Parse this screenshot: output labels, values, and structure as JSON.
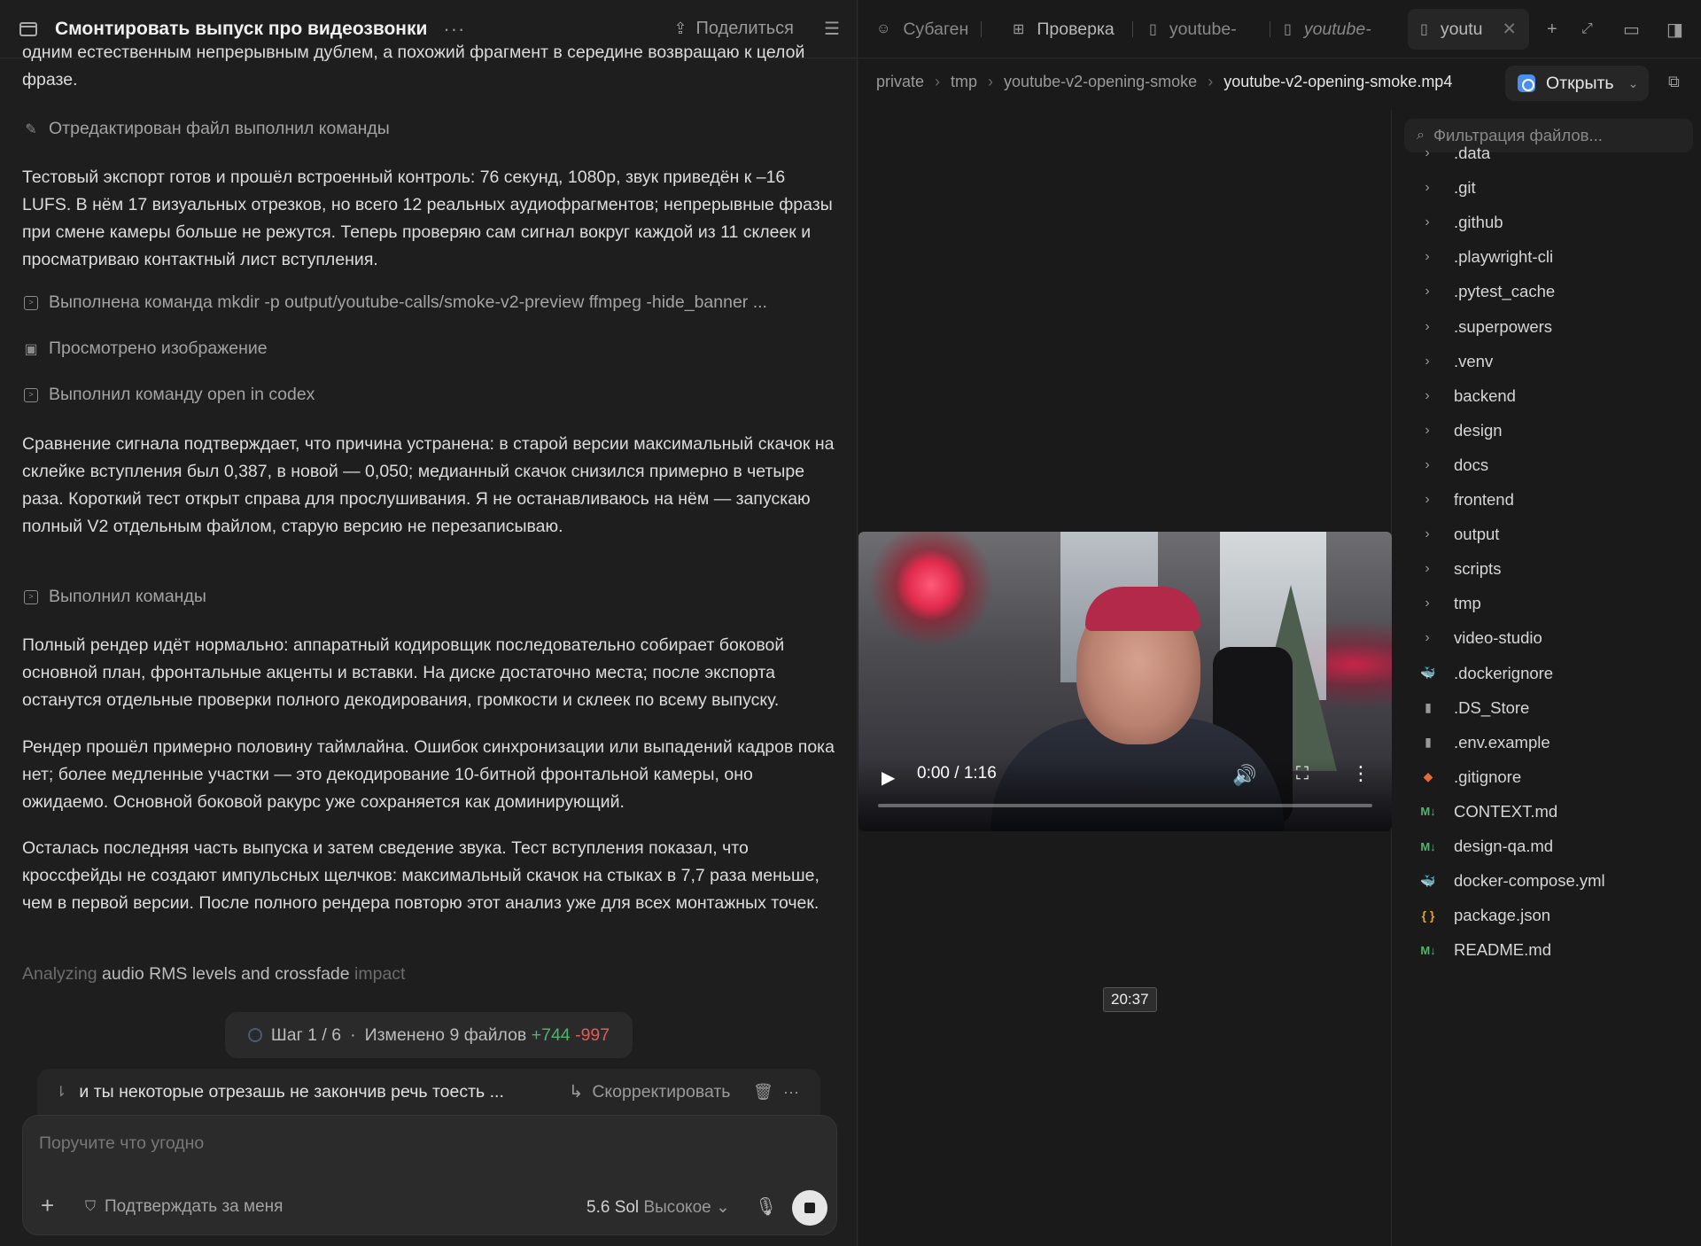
{
  "header": {
    "title": "Смонтировать выпуск про видеозвонки",
    "more": "···",
    "share_label": "Поделиться"
  },
  "chat": {
    "top_fragment": "одним естественным непрерывным дублем, а похожий фрагмент в середине возвращаю к целой фразе.",
    "actions": {
      "edited": "Отредактирован файл выполнил команды",
      "mkdir": "Выполнена команда mkdir -p output/youtube-calls/smoke-v2-preview ffmpeg -hide_banner ...",
      "viewed": "Просмотрено изображение",
      "open": "Выполнил команду open in codex",
      "commands": "Выполнил команды"
    },
    "p1": "Тестовый экспорт готов и прошёл встроенный контроль: 76 секунд, 1080p, звук приведён к –16 LUFS. В нём 17 визуальных отрезков, но всего 12 реальных аудиофрагментов; непрерывные фразы при смене камеры больше не режутся. Теперь проверяю сам сигнал вокруг каждой из 11 склеек и просматриваю контактный лист вступления.",
    "p2": "Сравнение сигнала подтверждает, что причина устранена: в старой версии максимальный скачок на склейке вступления был 0,387, в новой — 0,050; медианный скачок снизился примерно в четыре раза. Короткий тест открыт справа для прослушивания. Я не останавливаюсь на нём — запускаю полный V2 отдельным файлом, старую версию не перезаписываю.",
    "p3": "Полный рендер идёт нормально: аппаратный кодировщик последовательно собирает боковой основной план, фронтальные акценты и вставки. На диске достаточно места; после экспорта останутся отдельные проверки полного декодирования, громкости и склеек по всему выпуску.",
    "p4": "Рендер прошёл примерно половину таймлайна. Ошибок синхронизации или выпадений кадров пока нет; более медленные участки — это декодирование 10-битной фронтальной камеры, оно ожидаемо. Основной боковой ракурс уже сохраняется как доминирующий.",
    "p5": "Осталась последняя часть выпуска и затем сведение звука. Тест вступления показал, что кроссфейды не создают импульсных щелчков: максимальный скачок на стыках в 7,7 раза меньше, чем в первой версии. После полного рендера повторю этот анализ уже для всех монтажных точек.",
    "analyzing_pre": "Analyzing ",
    "analyzing_mid": "audio RMS levels and crossfade",
    "analyzing_post": " impact"
  },
  "progress": {
    "step": "Шаг 1 / 6",
    "dot": "·",
    "changed": "Изменено 9 файлов",
    "added": "+744",
    "removed": "-997"
  },
  "queued": {
    "text": "и ты некоторые отрезашь не закончив речь тоесть ...",
    "steer_label": "Скорректировать"
  },
  "composer": {
    "placeholder": "Поручите что угодно",
    "approve_label": "Подтверждать за меня",
    "model": "5.6 Sol",
    "level": "Высокое"
  },
  "tabs": [
    {
      "label": "Субаген",
      "icon": "agent-icon"
    },
    {
      "label": "Проверка",
      "icon": "review-icon"
    },
    {
      "label": "youtube-",
      "icon": "file-icon"
    },
    {
      "label": "youtube-",
      "icon": "file-icon"
    },
    {
      "label": "youtu",
      "icon": "file-icon"
    }
  ],
  "breadcrumb": {
    "items": [
      "private",
      "tmp",
      "youtube-v2-opening-smoke"
    ],
    "current": "youtube-v2-opening-smoke.mp4"
  },
  "open_button": "Открыть",
  "video": {
    "time": "0:00 / 1:16",
    "progress": 0.0,
    "tooltip": "20:37"
  },
  "files": {
    "filter_placeholder": "Фильтрация файлов...",
    "folders": [
      ".data",
      ".git",
      ".github",
      ".playwright-cli",
      ".pytest_cache",
      ".superpowers",
      ".venv",
      "backend",
      "design",
      "docs",
      "frontend",
      "output",
      "scripts",
      "tmp",
      "video-studio"
    ],
    "items": [
      {
        "name": ".dockerignore",
        "icon": "docker-icon"
      },
      {
        "name": ".DS_Store",
        "icon": "file-icon"
      },
      {
        "name": ".env.example",
        "icon": "file-icon"
      },
      {
        "name": ".gitignore",
        "icon": "git-icon"
      },
      {
        "name": "CONTEXT.md",
        "icon": "markdown-icon"
      },
      {
        "name": "design-qa.md",
        "icon": "markdown-icon"
      },
      {
        "name": "docker-compose.yml",
        "icon": "docker-icon"
      },
      {
        "name": "package.json",
        "icon": "json-icon"
      },
      {
        "name": "README.md",
        "icon": "markdown-icon"
      }
    ]
  },
  "colors": {
    "added": "#4fb36b",
    "removed": "#e05d5d",
    "accent": "#4a8ff0"
  }
}
